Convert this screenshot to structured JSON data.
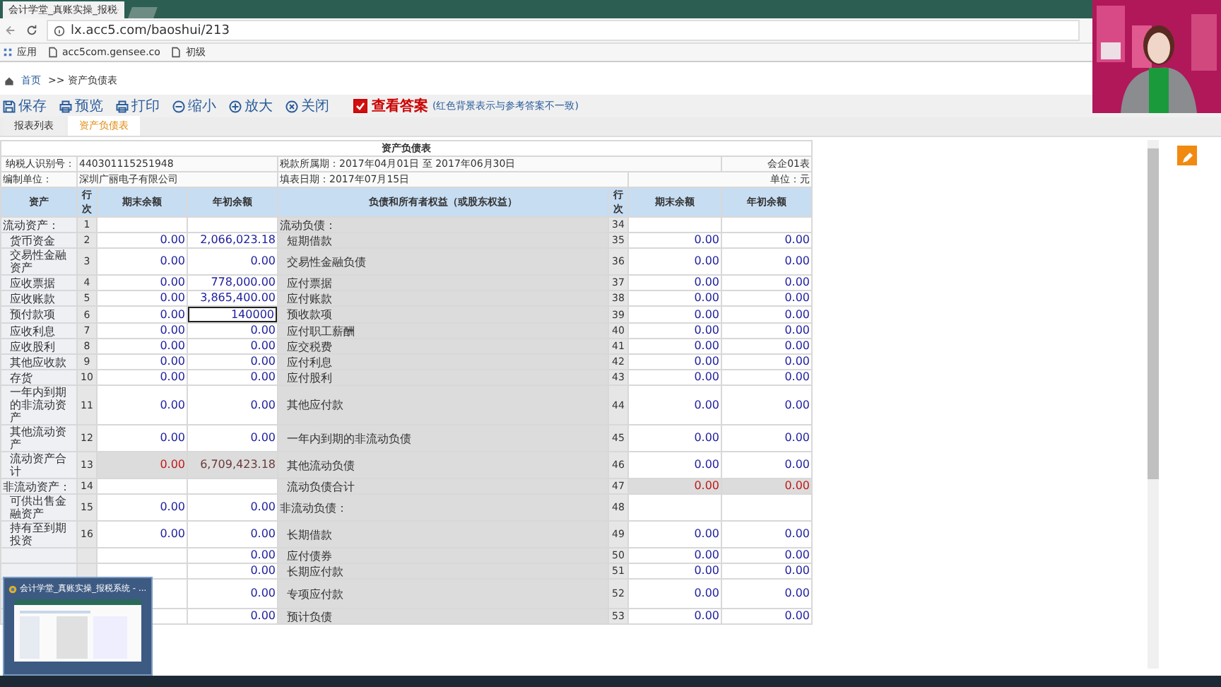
{
  "browser": {
    "tab_title": "会计学堂_真账实操_报税",
    "address": "lx.acc5.com/baoshui/213",
    "bookmarks": [
      "应用",
      "acc5com.gensee.co",
      "初级"
    ]
  },
  "breadcrumb": {
    "home": "首页",
    "current": ">> 资产负债表"
  },
  "toolbar": [
    "保存",
    "预览",
    "打印",
    "缩小",
    "放大",
    "关闭"
  ],
  "answer_toggle": {
    "label": "查看答案",
    "checked": true,
    "note": "(红色背景表示与参考答案不一致)"
  },
  "tabs": [
    {
      "label": "报表列表",
      "selected": false
    },
    {
      "label": "资产负债表",
      "selected": true
    }
  ],
  "report": {
    "title": "资产负债表",
    "taxpayer_id_label": "纳税人识别号：",
    "taxpayer_id": "440301115251948",
    "period": "税款所属期：2017年04月01日 至 2017年06月30日",
    "form_code": "会企01表",
    "unit_label": "编制单位：",
    "unit_name": "深圳广丽电子有限公司",
    "fill_date": "填表日期：2017年07月15日",
    "currency": "单位：元",
    "columns": [
      "资产",
      "行次",
      "期末余额",
      "年初余额",
      "负债和所有者权益（或股东权益）",
      "行次",
      "期末余额",
      "年初余额"
    ],
    "rows": [
      {
        "left": {
          "label": "流动资产：",
          "line": "1",
          "kind": "heading"
        },
        "right": {
          "label": "流动负债：",
          "line": "34",
          "kind": "heading"
        }
      },
      {
        "left": {
          "label": "货币资金",
          "line": "2",
          "end": "0.00",
          "begin": "2,066,023.18",
          "kind": "item"
        },
        "right": {
          "label": "短期借款",
          "line": "35",
          "end": "0.00",
          "begin": "0.00",
          "kind": "item"
        }
      },
      {
        "left": {
          "label": "交易性金融资产",
          "line": "3",
          "end": "0.00",
          "begin": "0.00",
          "kind": "item"
        },
        "right": {
          "label": "交易性金融负债",
          "line": "36",
          "end": "0.00",
          "begin": "0.00",
          "kind": "item"
        }
      },
      {
        "left": {
          "label": "应收票据",
          "line": "4",
          "end": "0.00",
          "begin": "778,000.00",
          "kind": "item"
        },
        "right": {
          "label": "应付票据",
          "line": "37",
          "end": "0.00",
          "begin": "0.00",
          "kind": "item"
        }
      },
      {
        "left": {
          "label": "应收账款",
          "line": "5",
          "end": "0.00",
          "begin": "3,865,400.00",
          "kind": "item"
        },
        "right": {
          "label": "应付账款",
          "line": "38",
          "end": "0.00",
          "begin": "0.00",
          "kind": "item"
        }
      },
      {
        "left": {
          "label": "预付款项",
          "line": "6",
          "end": "0.00",
          "begin": "140000",
          "kind": "item",
          "focused": true
        },
        "right": {
          "label": "预收款项",
          "line": "39",
          "end": "0.00",
          "begin": "0.00",
          "kind": "item"
        }
      },
      {
        "left": {
          "label": "应收利息",
          "line": "7",
          "end": "0.00",
          "begin": "0.00",
          "kind": "item"
        },
        "right": {
          "label": "应付职工薪酬",
          "line": "40",
          "end": "0.00",
          "begin": "0.00",
          "kind": "item"
        }
      },
      {
        "left": {
          "label": "应收股利",
          "line": "8",
          "end": "0.00",
          "begin": "0.00",
          "kind": "item"
        },
        "right": {
          "label": "应交税费",
          "line": "41",
          "end": "0.00",
          "begin": "0.00",
          "kind": "item"
        }
      },
      {
        "left": {
          "label": "其他应收款",
          "line": "9",
          "end": "0.00",
          "begin": "0.00",
          "kind": "item"
        },
        "right": {
          "label": "应付利息",
          "line": "42",
          "end": "0.00",
          "begin": "0.00",
          "kind": "item"
        }
      },
      {
        "left": {
          "label": "存货",
          "line": "10",
          "end": "0.00",
          "begin": "0.00",
          "kind": "item"
        },
        "right": {
          "label": "应付股利",
          "line": "43",
          "end": "0.00",
          "begin": "0.00",
          "kind": "item"
        }
      },
      {
        "left": {
          "label": "一年内到期的非流动资产",
          "line": "11",
          "end": "0.00",
          "begin": "0.00",
          "kind": "item"
        },
        "right": {
          "label": "其他应付款",
          "line": "44",
          "end": "0.00",
          "begin": "0.00",
          "kind": "item"
        }
      },
      {
        "left": {
          "label": "其他流动资产",
          "line": "12",
          "end": "0.00",
          "begin": "0.00",
          "kind": "item"
        },
        "right": {
          "label": "一年内到期的非流动负债",
          "line": "45",
          "end": "0.00",
          "begin": "0.00",
          "kind": "item"
        }
      },
      {
        "left": {
          "label": "流动资产合计",
          "line": "13",
          "end": "0.00",
          "begin": "6,709,423.18",
          "kind": "total"
        },
        "right": {
          "label": "其他流动负债",
          "line": "46",
          "end": "0.00",
          "begin": "0.00",
          "kind": "item"
        }
      },
      {
        "left": {
          "label": "非流动资产：",
          "line": "14",
          "kind": "heading"
        },
        "right": {
          "label": "流动负债合计",
          "line": "47",
          "end": "0.00",
          "begin": "0.00",
          "kind": "total"
        }
      },
      {
        "left": {
          "label": "可供出售金融资产",
          "line": "15",
          "end": "0.00",
          "begin": "0.00",
          "kind": "item"
        },
        "right": {
          "label": "非流动负债：",
          "line": "48",
          "kind": "heading"
        }
      },
      {
        "left": {
          "label": "持有至到期投资",
          "line": "16",
          "end": "0.00",
          "begin": "0.00",
          "kind": "item"
        },
        "right": {
          "label": "长期借款",
          "line": "49",
          "end": "0.00",
          "begin": "0.00",
          "kind": "item"
        }
      },
      {
        "left": {
          "begin": "0.00",
          "kind": "item"
        },
        "right": {
          "label": "应付债券",
          "line": "50",
          "end": "0.00",
          "begin": "0.00",
          "kind": "item"
        }
      },
      {
        "left": {
          "begin": "0.00",
          "kind": "item"
        },
        "right": {
          "label": "长期应付款",
          "line": "51",
          "end": "0.00",
          "begin": "0.00",
          "kind": "item"
        }
      },
      {
        "left": {
          "begin": "0.00",
          "kind": "item"
        },
        "right": {
          "label": "专项应付款",
          "line": "52",
          "end": "0.00",
          "begin": "0.00",
          "kind": "item"
        }
      },
      {
        "left": {
          "begin": "0.00",
          "kind": "item"
        },
        "right": {
          "label": "预计负债",
          "line": "53",
          "end": "0.00",
          "begin": "0.00",
          "kind": "item"
        }
      }
    ]
  },
  "thumbnail": {
    "title": "会计学堂_真账实操_报税系统 - ..."
  }
}
